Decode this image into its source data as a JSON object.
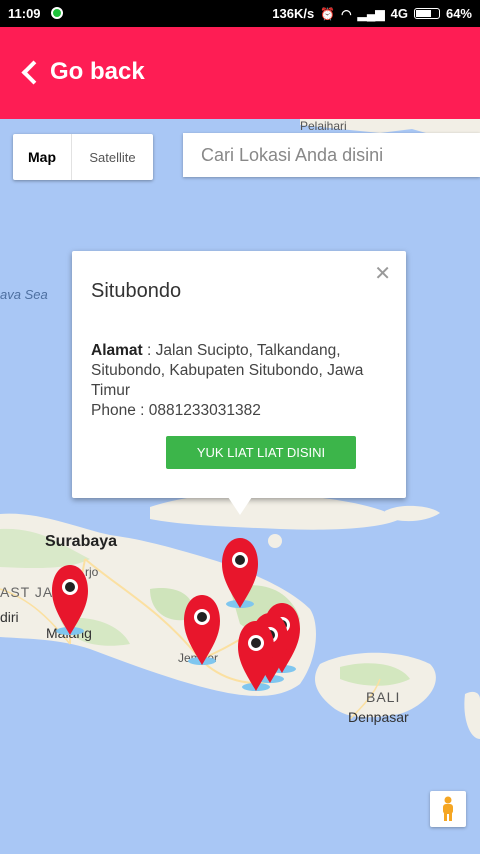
{
  "status_bar": {
    "time": "11:09",
    "speed": "136K/s",
    "network": "4G",
    "battery": "64%"
  },
  "header": {
    "back_label": "Go back",
    "background": "#fe1d54"
  },
  "map": {
    "type_map": "Map",
    "type_satellite": "Satellite",
    "search_placeholder": "Cari Lokasi Anda disini",
    "labels": {
      "pelaihari": "Pelaihari",
      "java_sea": "ava Sea",
      "surabaya": "Surabaya",
      "sidoarjo": "rjo",
      "east_java": "AST JAV",
      "kediri": "diri",
      "malang": "Malang",
      "jember": "Jember",
      "bali": "BALI",
      "denpasar": "Denpasar"
    }
  },
  "popup": {
    "title": "Situbondo",
    "address_label": "Alamat",
    "address": "Jalan Sucipto, Talkandang, Situbondo, Kabupaten Situbondo, Jawa Timur",
    "phone_label": "Phone :",
    "phone": "0881233031382",
    "cta": "YUK LIAT LIAT DISINI",
    "cta_color": "#3cb54a"
  },
  "colors": {
    "sea": "#a9c7f5",
    "land": "#f2efe6",
    "marker": "#e8162c"
  }
}
